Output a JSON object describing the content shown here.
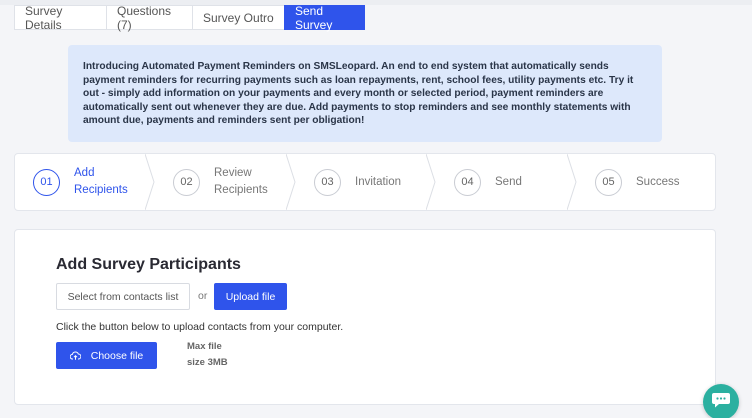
{
  "tabs": [
    {
      "label": "Survey Details"
    },
    {
      "label": "Questions (7)"
    },
    {
      "label": "Survey Outro"
    },
    {
      "label": "Send Survey"
    }
  ],
  "notice": {
    "text": "Introducing Automated Payment Reminders on SMSLeopard. An end to end system that automatically sends payment reminders for recurring payments such as loan repayments, rent, school fees, utility payments etc. Try it out - simply add information on your payments and every month or selected period, payment reminders are automatically sent out whenever they are due. Add payments to stop reminders and see monthly statements with amount due, payments and reminders sent per obligation!"
  },
  "steps": [
    {
      "num": "01",
      "line1": "Add",
      "line2": "Recipients"
    },
    {
      "num": "02",
      "line1": "Review",
      "line2": "Recipients"
    },
    {
      "num": "03",
      "line1": "Invitation",
      "line2": ""
    },
    {
      "num": "04",
      "line1": "Send",
      "line2": ""
    },
    {
      "num": "05",
      "line1": "Success",
      "line2": ""
    }
  ],
  "main": {
    "title": "Add Survey Participants",
    "select_contacts": "Select from contacts list",
    "or": "or",
    "upload_file": "Upload file",
    "hint": "Click the button below to upload contacts from your computer.",
    "choose_file": "Choose file",
    "max_line1": "Max file",
    "max_line2": "size 3MB"
  },
  "colors": {
    "accent": "#2f54eb",
    "notice_bg": "#dde8fb",
    "chat": "#2bb0a0"
  },
  "icons": {
    "upload": "cloud-upload-icon",
    "chat": "chat-icon"
  }
}
